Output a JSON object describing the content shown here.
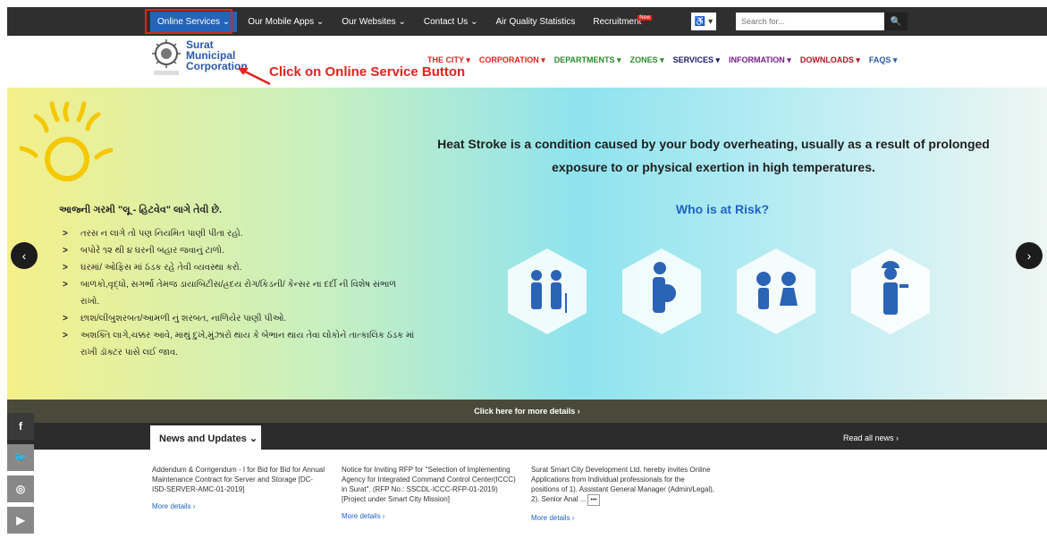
{
  "topnav": {
    "items": [
      {
        "label": "Online Services ⌄",
        "active": true
      },
      {
        "label": "Our Mobile Apps ⌄"
      },
      {
        "label": "Our Websites ⌄"
      },
      {
        "label": "Contact Us ⌄"
      },
      {
        "label": "Air Quality Statistics"
      },
      {
        "label": "Recruitment",
        "badge": "New"
      }
    ],
    "accessibility": "♿ ▾",
    "search_placeholder": "Search for..."
  },
  "header": {
    "brand": [
      "Surat",
      "Municipal",
      "Corporation"
    ],
    "annotation": "Click on Online Service Button",
    "mainnav": [
      {
        "label": "THE CITY ▾",
        "color": "#e0241c"
      },
      {
        "label": "CORPORATION ▾",
        "color": "#e0241c"
      },
      {
        "label": "DEPARTMENTS ▾",
        "color": "#2a8a2a"
      },
      {
        "label": "ZONES ▾",
        "color": "#2a8a2a"
      },
      {
        "label": "SERVICES ▾",
        "color": "#1b1b6e"
      },
      {
        "label": "INFORMATION ▾",
        "color": "#7a1d8f"
      },
      {
        "label": "DOWNLOADS ▾",
        "color": "#b0151b"
      },
      {
        "label": "FAQS ▾",
        "color": "#2a5aa8"
      }
    ]
  },
  "banner": {
    "title": "Heat Stroke is a condition caused by your body overheating, usually as a result of prolonged exposure to or physical exertion in high temperatures.",
    "subtitle": "Who is at Risk?",
    "guj_heading": "આજ્ની ગરમી \"લૂ - હિટવેવ\" લાગે તેવી છે.",
    "guj_list": [
      "તરસ ન લાગે તો પણ નિયમિત પાણી પીતા રહો.",
      "બપોરે ૧૨ થી ૪ ઘરની બહાર જવાનું ટાળો.",
      "ઘરમાં/ ઓફિસ માં ઠંડક રહે તેવી વ્યવસ્થા કરો.",
      "બાળકો,વૃદ્ધો, સગર્ભા તેમજ ડાયાબિટીસ/હ્રદય રોગ/કિડની/ કેન્સર ના દર્દી ની વિશેષ સંભાળ રાખો.",
      "છાશ/લીંબુશરબત/આમળી નું શરબત, નાળિયેર પાણી પીઓ.",
      "અશક્તિ લાગે,ચક્કર આવે, માથું દુખે,મુંઝારો થાય કે બેભાન થાય તેવા લોકોને તાત્કાલિક ઠંડક માં રાખી ડૉક્ટર પાસે લઈ જાવ."
    ],
    "prev": "‹",
    "next": "›"
  },
  "details_bar": "Click here for more details ›",
  "news": {
    "tab": "News and Updates ⌄",
    "read_all": "Read all news ›",
    "items": [
      {
        "text": "Addendum & Corrigendum - I for Bid for Bid for Annual Maintenance Contract for Server and Storage [DC-ISD-SERVER-AMC-01-2019]",
        "more": "More details ›"
      },
      {
        "text": "Notice for Inviting RFP for \"Selection of Implementing Agency for Integrated Command Control Center(ICCC) in Surat\". (RFP No.: SSCDL-ICCC-RFP-01-2019) [Project under Smart City Mission]",
        "more": "More details ›"
      },
      {
        "text": "Surat Smart City Development Ltd. hereby invites Online Applications from Individual professionals for the positions of 1). Assistant General Manager (Admin/Legal), 2). Senior Anal ...",
        "more": "More details ›"
      }
    ]
  },
  "social": [
    "f",
    "🐦",
    "◎",
    "▶"
  ]
}
